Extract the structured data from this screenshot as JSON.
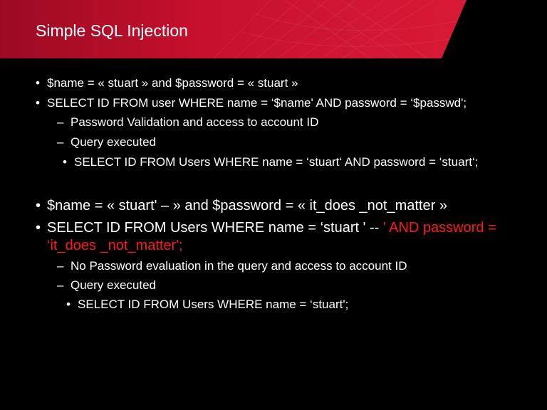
{
  "slide": {
    "title": "Simple SQL Injection",
    "colors": {
      "banner": "#c8102e",
      "background": "#000000",
      "text": "#ffffff",
      "highlight": "#ff1a1a"
    },
    "example1": {
      "line1": "$name = « stuart » and $password = « stuart »",
      "line2": "SELECT ID FROM user WHERE name = ‘$name' AND password = ‘$passwd';",
      "sub1": "Password Validation and access to account ID",
      "sub2": "Query executed",
      "subsub1": "SELECT ID FROM Users WHERE name = ‘stuart‘ AND password = ‘stuart‘;"
    },
    "example2": {
      "line1": "$name = « stuart' – » and $password = « it_does _not_matter »",
      "line2_white": "SELECT ID FROM Users WHERE name = ‘stuart ' -- ",
      "line2_red": "' AND password =",
      "line3_red": "‘it_does _not_matter';",
      "sub1": "No Password evaluation in the query and access to account ID",
      "sub2": "Query executed",
      "subsub1": "SELECT ID FROM Users WHERE name = ‘stuart';"
    },
    "bullets": {
      "round": "•",
      "dash": "–"
    }
  }
}
